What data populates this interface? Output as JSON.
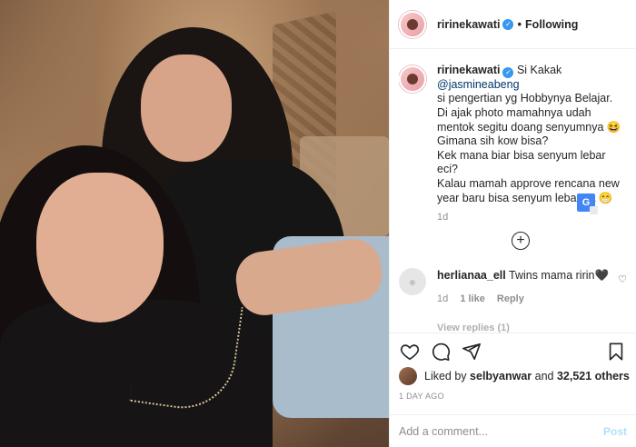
{
  "post": {
    "username": "ririnekawati",
    "follow_status": "Following",
    "separator": "•"
  },
  "caption": {
    "username": "ririnekawati",
    "lines": [
      "Si Kakak",
      "@jasmineabeng",
      "si pengertian yg Hobbynya Belajar.",
      "Di ajak photo mamahnya udah",
      "mentok segitu doang senyumnya 😆",
      "Gimana sih kow bisa?",
      "Kek mana biar bisa senyum lebar eci?",
      "Kalau mamah approve rencana new",
      "year baru bisa senyum lebar ya 😁"
    ],
    "age": "1d"
  },
  "comment": {
    "username": "herlianaa_ell",
    "text": "Twins mama ririn🖤",
    "age": "1d",
    "likes": "1 like",
    "reply": "Reply",
    "view_replies": "View replies (1)"
  },
  "likes": {
    "prefix": "Liked by",
    "user": "selbyanwar",
    "joiner": "and",
    "others": "32,521 others"
  },
  "date": "1 DAY AGO",
  "add_comment": {
    "placeholder": "Add a comment...",
    "post_label": "Post"
  },
  "colors": {
    "verified": "#3897f0",
    "post_disabled": "#b2dffc",
    "muted": "#8e8e8e"
  },
  "icons": [
    "verified-icon",
    "translate-icon",
    "load-more-icon",
    "heart-icon",
    "comment-icon",
    "share-icon",
    "bookmark-icon"
  ]
}
